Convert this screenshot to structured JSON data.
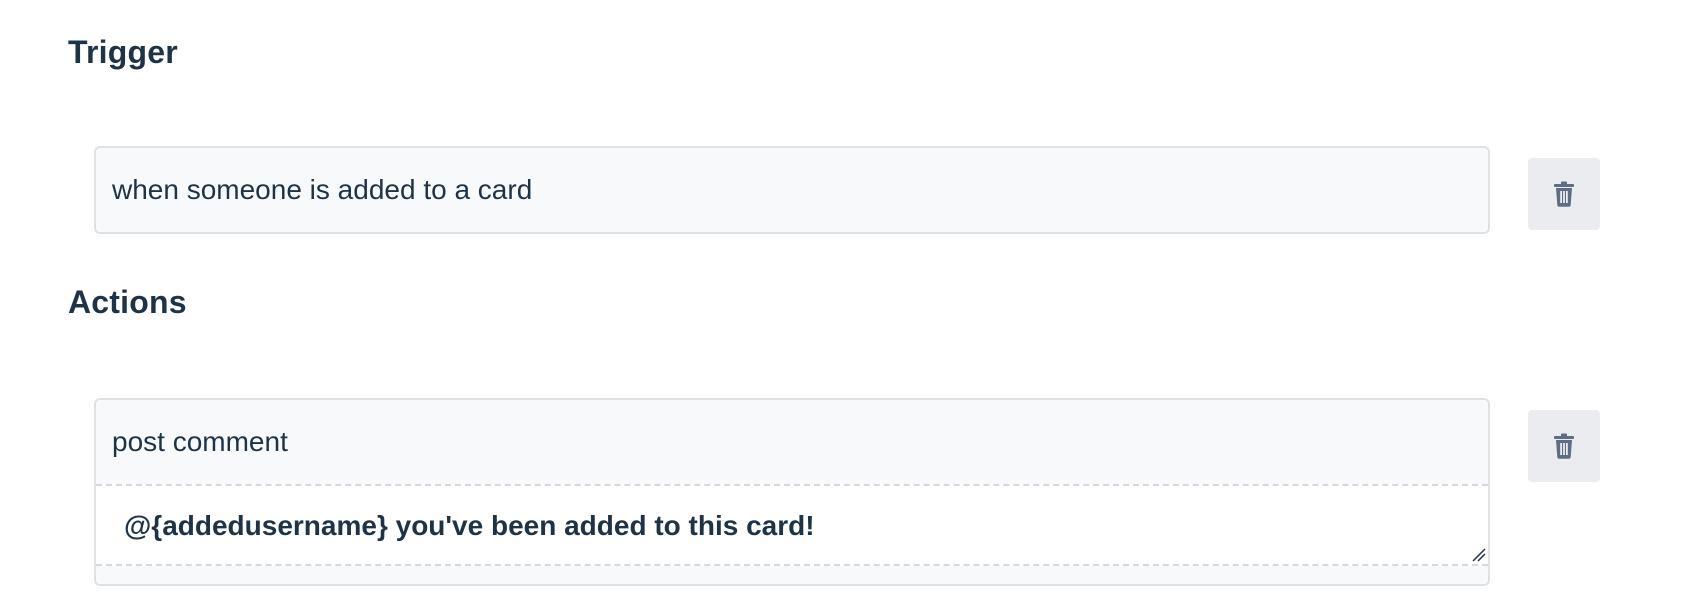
{
  "trigger": {
    "heading": "Trigger",
    "value": "when someone is added to a card",
    "delete_icon": "trash-icon"
  },
  "actions": {
    "heading": "Actions",
    "items": [
      {
        "type": "post comment",
        "comment": "@{addedusername} you've been added to this card!",
        "delete_icon": "trash-icon"
      }
    ]
  },
  "colors": {
    "text": "#1f3347",
    "card_background": "#f8f9fb",
    "card_border": "#dfe1e6",
    "button_background": "#ebecf0",
    "icon": "#5e6c84"
  }
}
